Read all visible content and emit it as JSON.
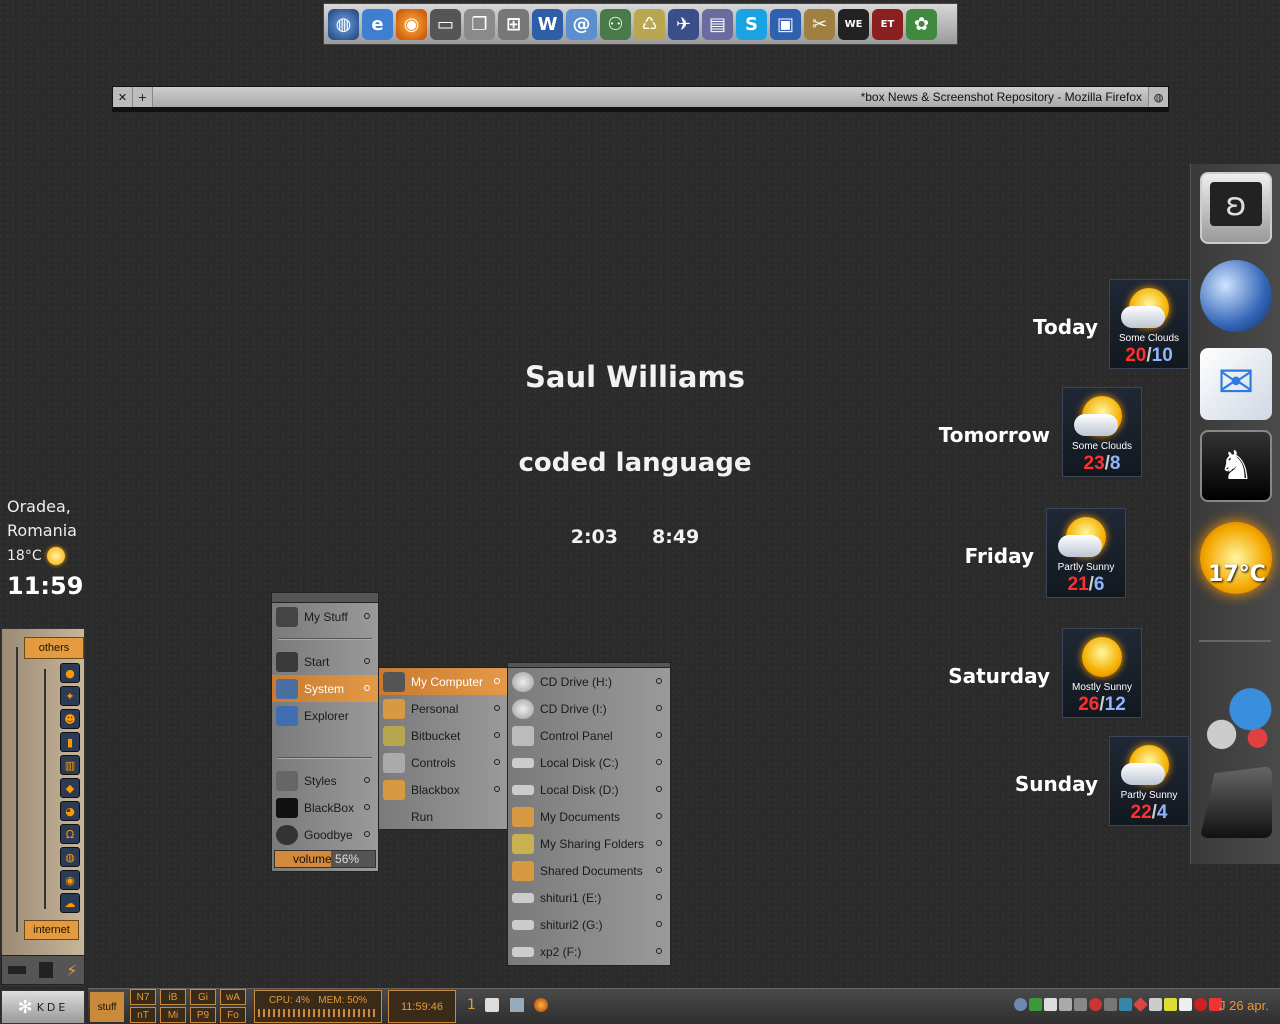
{
  "top_dock": {
    "icons": [
      "google-earth-icon",
      "internet-explorer-icon",
      "firefox-icon",
      "my-computer-icon",
      "documents-icon",
      "network-icon",
      "word-icon",
      "outlook-icon",
      "network-connection-icon",
      "recycle-bin-icon",
      "jet-icon",
      "book-icon",
      "skype-icon",
      "floppy-icon",
      "scissors-icon",
      "winning-eleven-icon",
      "game-icon",
      "leaf-icon"
    ]
  },
  "firefox_bar": {
    "title": "*box News & Screenshot Repository - Mozilla Firefox"
  },
  "now_playing": {
    "artist": "Saul Williams",
    "track": "coded language",
    "elapsed": "2:03",
    "length": "8:49"
  },
  "left_weather": {
    "city": "Oradea,",
    "country": "Romania",
    "temp": "18°C",
    "clock": "11:59"
  },
  "left_panel": {
    "group_top": "others",
    "group_bottom": "internet"
  },
  "kde_label": "KDE",
  "menu1": {
    "items": [
      {
        "label": "My Stuff"
      },
      {
        "label": "Start"
      },
      {
        "label": "System"
      },
      {
        "label": "Explorer"
      },
      {
        "label": "Styles"
      },
      {
        "label": "BlackBox"
      },
      {
        "label": "Goodbye"
      }
    ],
    "volume_label": "volume",
    "volume_value": "56%",
    "volume_level": 0.56
  },
  "menu2": {
    "items": [
      {
        "label": "My Computer"
      },
      {
        "label": "Personal"
      },
      {
        "label": "Bitbucket"
      },
      {
        "label": "Controls"
      },
      {
        "label": "Blackbox"
      },
      {
        "label": "Run"
      }
    ]
  },
  "menu3": {
    "items": [
      {
        "label": "CD Drive (H:)"
      },
      {
        "label": "CD Drive (I:)"
      },
      {
        "label": "Control Panel"
      },
      {
        "label": "Local Disk (C:)"
      },
      {
        "label": "Local Disk (D:)"
      },
      {
        "label": "My Documents"
      },
      {
        "label": "My Sharing Folders"
      },
      {
        "label": "Shared Documents"
      },
      {
        "label": "shituri1 (E:)"
      },
      {
        "label": "shituri2 (G:)"
      },
      {
        "label": "xp2 (F:)"
      }
    ]
  },
  "forecast": [
    {
      "day": "Today",
      "cond": "Some Clouds",
      "hi": "20",
      "lo": "10"
    },
    {
      "day": "Tomorrow",
      "cond": "Some Clouds",
      "hi": "23",
      "lo": "8"
    },
    {
      "day": "Friday",
      "cond": "Partly Sunny",
      "hi": "21",
      "lo": "6"
    },
    {
      "day": "Saturday",
      "cond": "Mostly Sunny",
      "hi": "26",
      "lo": "12"
    },
    {
      "day": "Sunday",
      "cond": "Partly Sunny",
      "hi": "22",
      "lo": "4"
    }
  ],
  "right_dock": {
    "temp": "17°C"
  },
  "taskbar": {
    "workspace": "stuff",
    "tasks_top": [
      "N7",
      "iB",
      "Gi",
      "wA"
    ],
    "tasks_bottom": [
      "nT",
      "Mi",
      "P9",
      "Fo"
    ],
    "cpu": "CPU: 4%",
    "mem": "MEM: 50%",
    "clock": "11:59:46",
    "desk_num": "1",
    "date": "J 26 apr."
  },
  "colors": {
    "accent": "#e49a3e",
    "hi": "#ff3030",
    "lo": "#8fb5ff"
  }
}
